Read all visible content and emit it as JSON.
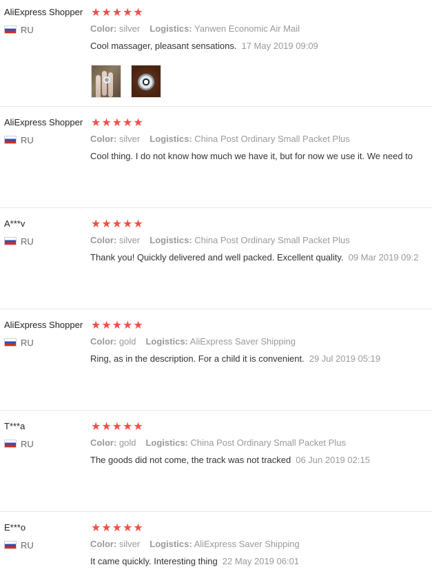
{
  "reviews": [
    {
      "user": "AliExpress Shopper",
      "country": "RU",
      "rating": 5,
      "color_label": "Color:",
      "color": "silver",
      "logistics_label": "Logistics:",
      "logistics": "Yanwen Economic Air Mail",
      "text": "Cool massager, pleasant sensations.",
      "date": "17 May 2019 09:09",
      "photos": [
        "photo-hand-ring",
        "photo-ring-closeup"
      ]
    },
    {
      "user": "AliExpress Shopper",
      "country": "RU",
      "rating": 5,
      "color_label": "Color:",
      "color": "silver",
      "logistics_label": "Logistics:",
      "logistics": "China Post Ordinary Small Packet Plus",
      "text": "Cool thing. I do not know how much we have it, but for now we use it. We need to",
      "date": ""
    },
    {
      "user": "A***v",
      "country": "RU",
      "rating": 5,
      "color_label": "Color:",
      "color": "silver",
      "logistics_label": "Logistics:",
      "logistics": "China Post Ordinary Small Packet Plus",
      "text": "Thank you! Quickly delivered and well packed. Excellent quality.",
      "date": "09 Mar 2019 09:2"
    },
    {
      "user": "AliExpress Shopper",
      "country": "RU",
      "rating": 5,
      "color_label": "Color:",
      "color": "gold",
      "logistics_label": "Logistics:",
      "logistics": "AliExpress Saver Shipping",
      "text": "Ring, as in the description. For a child it is convenient.",
      "date": "29 Jul 2019 05:19"
    },
    {
      "user": "T***a",
      "country": "RU",
      "rating": 5,
      "color_label": "Color:",
      "color": "gold",
      "logistics_label": "Logistics:",
      "logistics": "China Post Ordinary Small Packet Plus",
      "text": "The goods did not come, the track was not tracked",
      "date": "06 Jun 2019 02:15"
    },
    {
      "user": "E***o",
      "country": "RU",
      "rating": 5,
      "color_label": "Color:",
      "color": "silver",
      "logistics_label": "Logistics:",
      "logistics": "AliExpress Saver Shipping",
      "text": "It came quickly. Interesting thing",
      "date": "22 May 2019 06:01"
    }
  ],
  "colors": {
    "star": "#f04f49",
    "meta": "#999999",
    "text": "#333333"
  },
  "icons": {
    "star": "star-icon",
    "flag": "russia-flag-icon"
  }
}
